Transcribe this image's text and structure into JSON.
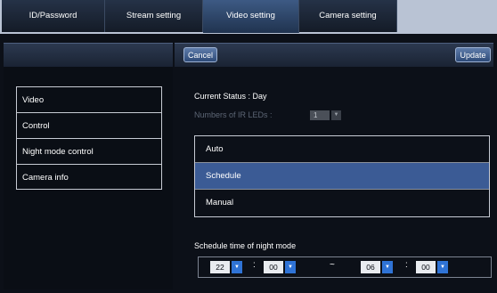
{
  "tabs": [
    {
      "label": "ID/Password"
    },
    {
      "label": "Stream setting"
    },
    {
      "label": "Video setting"
    },
    {
      "label": "Camera setting"
    }
  ],
  "toolbar": {
    "cancel_label": "Cancel",
    "update_label": "Update"
  },
  "sidebar": {
    "items": [
      {
        "label": "Video"
      },
      {
        "label": "Control"
      },
      {
        "label": "Night mode control"
      },
      {
        "label": "Camera info"
      }
    ]
  },
  "content": {
    "current_status": "Current Status : Day",
    "ir_label": "Numbers of IR LEDs :",
    "ir_value": "1",
    "modes": [
      {
        "label": "Auto"
      },
      {
        "label": "Schedule"
      },
      {
        "label": "Manual"
      }
    ],
    "schedule_label": "Schedule time of night mode",
    "schedule": {
      "start_hour": "22",
      "start_minute": "00",
      "range_sep": "~",
      "end_hour": "06",
      "end_minute": "00",
      "colon": ":"
    }
  },
  "colors": {
    "selected_mode": "#3b5b95",
    "select_arrow": "#2f73d6"
  }
}
